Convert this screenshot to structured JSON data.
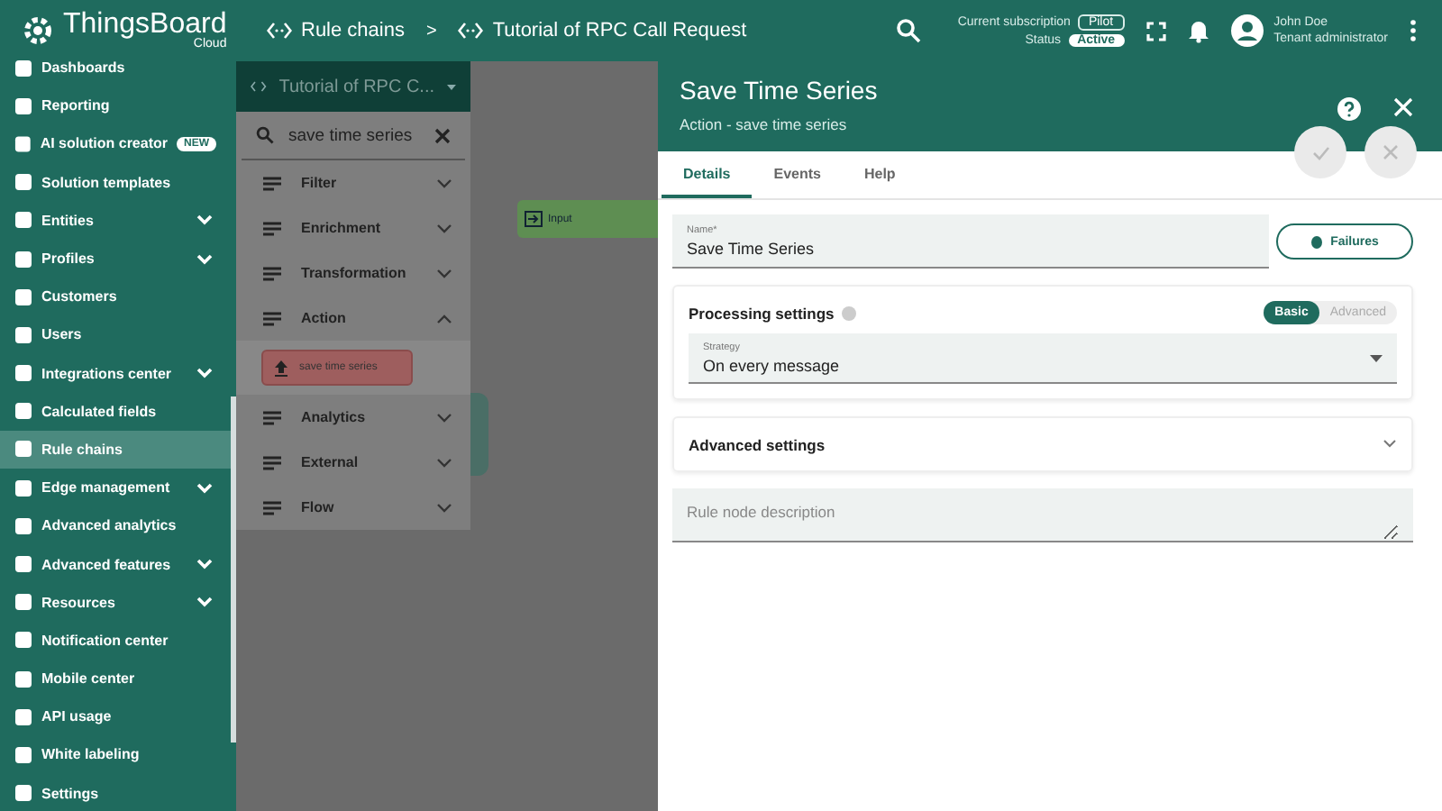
{
  "app": {
    "brand": "ThingsBoard",
    "edition": "Cloud"
  },
  "breadcrumbs": [
    {
      "label": "Rule chains"
    },
    {
      "label": "Tutorial of RPC Call Request"
    }
  ],
  "breadcrumb_separator": ">",
  "header": {
    "subscription_label": "Current subscription",
    "subscription": "Pilot",
    "status_label": "Status",
    "status": "Active",
    "user_name": "John Doe",
    "user_role": "Tenant administrator"
  },
  "sidebar": {
    "items": [
      {
        "label": "Dashboards",
        "selected": false,
        "expandable": false
      },
      {
        "label": "Reporting",
        "selected": false,
        "expandable": false
      },
      {
        "label": "AI solution creator",
        "selected": false,
        "expandable": false,
        "badge": "NEW"
      },
      {
        "label": "Solution templates",
        "selected": false,
        "expandable": false
      },
      {
        "label": "Entities",
        "selected": false,
        "expandable": true
      },
      {
        "label": "Profiles",
        "selected": false,
        "expandable": true
      },
      {
        "label": "Customers",
        "selected": false,
        "expandable": false
      },
      {
        "label": "Users",
        "selected": false,
        "expandable": false
      },
      {
        "label": "Integrations center",
        "selected": false,
        "expandable": true
      },
      {
        "label": "Calculated fields",
        "selected": false,
        "expandable": false
      },
      {
        "label": "Rule chains",
        "selected": true,
        "expandable": false
      },
      {
        "label": "Edge management",
        "selected": false,
        "expandable": true
      },
      {
        "label": "Advanced analytics",
        "selected": false,
        "expandable": false
      },
      {
        "label": "Advanced features",
        "selected": false,
        "expandable": true
      },
      {
        "label": "Resources",
        "selected": false,
        "expandable": true
      },
      {
        "label": "Notification center",
        "selected": false,
        "expandable": false
      },
      {
        "label": "Mobile center",
        "selected": false,
        "expandable": false
      },
      {
        "label": "API usage",
        "selected": false,
        "expandable": false
      },
      {
        "label": "White labeling",
        "selected": false,
        "expandable": false
      },
      {
        "label": "Settings",
        "selected": false,
        "expandable": false
      }
    ]
  },
  "library": {
    "chain": "Tutorial of RPC C...",
    "search": "save time series",
    "categories": [
      {
        "label": "Filter",
        "expanded": false
      },
      {
        "label": "Enrichment",
        "expanded": false
      },
      {
        "label": "Transformation",
        "expanded": false
      },
      {
        "label": "Action",
        "expanded": true,
        "nodes": [
          {
            "label": "save time series"
          }
        ]
      },
      {
        "label": "Analytics",
        "expanded": false
      },
      {
        "label": "External",
        "expanded": false
      },
      {
        "label": "Flow",
        "expanded": false
      }
    ]
  },
  "canvas": {
    "nodes": [
      {
        "label": "Input"
      }
    ]
  },
  "panel": {
    "title": "Save Time Series",
    "subtitle": "Action - save time series",
    "tabs": [
      {
        "label": "Details",
        "selected": true
      },
      {
        "label": "Events",
        "selected": false
      },
      {
        "label": "Help",
        "selected": false
      }
    ],
    "name_label": "Name*",
    "name_value": "Save Time Series",
    "failures_button": "Failures",
    "processing": {
      "title": "Processing settings",
      "modes": [
        {
          "label": "Basic",
          "selected": true
        },
        {
          "label": "Advanced",
          "selected": false
        }
      ],
      "strategy_label": "Strategy",
      "strategy_value": "On every message"
    },
    "advanced": {
      "title": "Advanced settings",
      "expanded": false
    },
    "description": {
      "placeholder": "Rule node description"
    }
  }
}
